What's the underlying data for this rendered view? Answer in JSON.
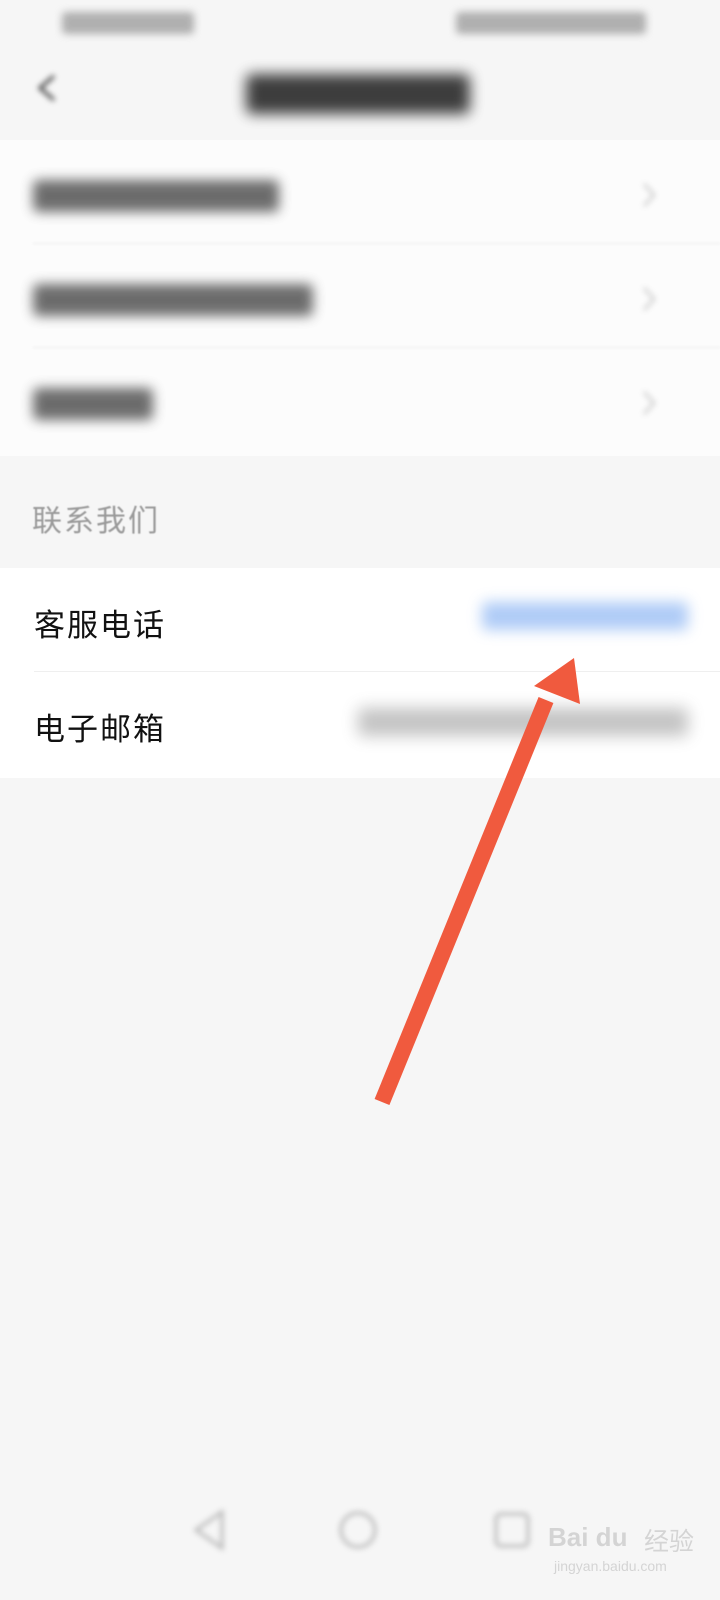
{
  "contact_section": {
    "header": "联系我们",
    "rows": [
      {
        "label": "客服电话"
      },
      {
        "label": "电子邮箱"
      }
    ]
  },
  "annotation": {
    "arrow_color": "#f05a3e"
  },
  "colors": {
    "background": "#f6f6f6",
    "card": "#ffffff",
    "phone_link": "#6ea2f0"
  },
  "icons": [
    "back-arrow-icon",
    "chevron-right-icon",
    "nav-back-icon",
    "nav-home-icon",
    "nav-recents-icon"
  ],
  "watermark": {
    "brand": "Bai du",
    "cn": "经验",
    "url": "jingyan.baidu.com"
  }
}
